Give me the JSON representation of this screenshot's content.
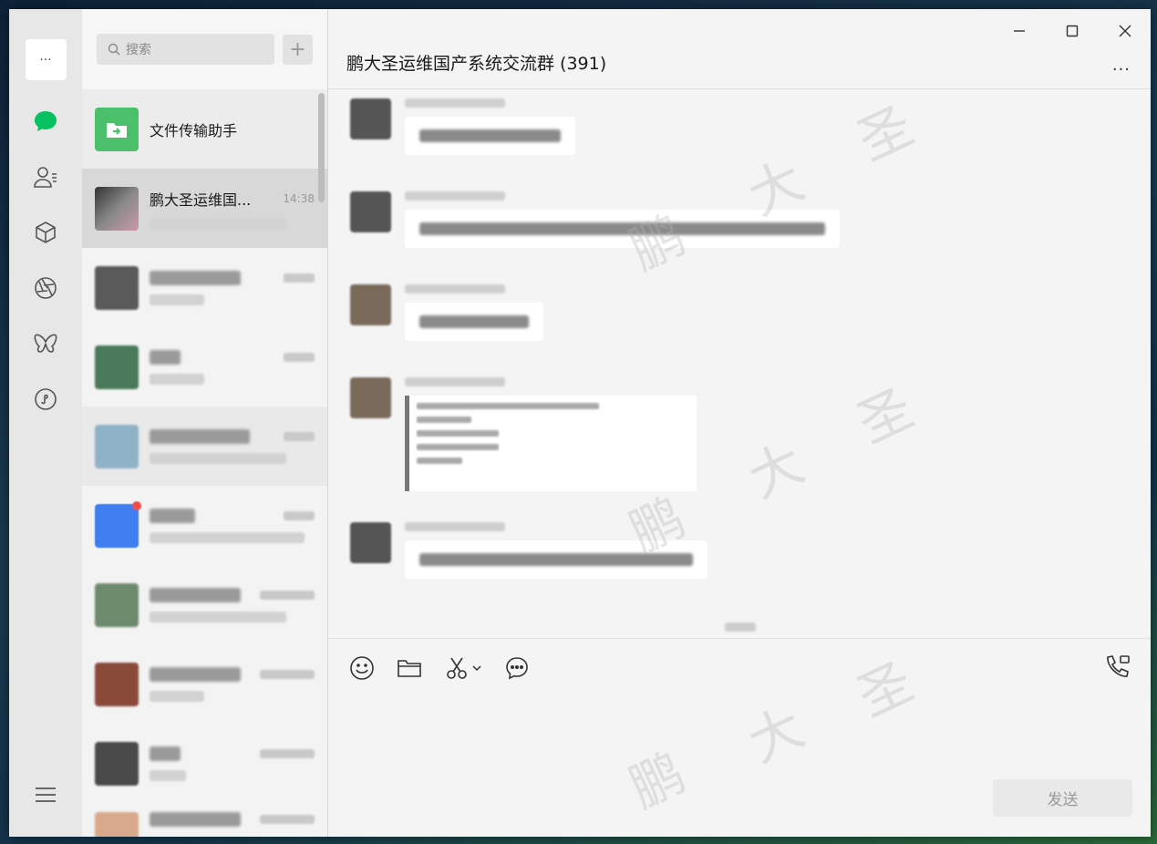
{
  "rail": {
    "menu_dots": "···",
    "icons": [
      "chat-bubble-icon",
      "contacts-icon",
      "cube-icon",
      "aperture-icon",
      "butterfly-icon",
      "mini-program-icon"
    ],
    "active_color": "#07c160",
    "bottom_icon": "menu-icon"
  },
  "sidebar": {
    "search_placeholder": "搜索",
    "add_symbol": "+",
    "conversations": [
      {
        "name": "文件传输助手",
        "time": "",
        "avatar_color": "#4cbf6b"
      },
      {
        "name": "鹏大圣运维国...",
        "time": "14:38",
        "avatar_color": "#6b6b6b"
      },
      {
        "name": "",
        "time": "",
        "avatar_color": "#5a5a5a"
      },
      {
        "name": "",
        "time": "",
        "avatar_color": "#4a7a5a"
      },
      {
        "name": "",
        "time": "",
        "avatar_color": "#8fb2c9"
      },
      {
        "name": "",
        "time": "",
        "avatar_color": "#3f7ef0",
        "badge": true
      },
      {
        "name": "",
        "time": "",
        "avatar_color": "#6d8a6d"
      },
      {
        "name": "",
        "time": "",
        "avatar_color": "#8a4a3a"
      },
      {
        "name": "",
        "time": "",
        "avatar_color": "#4a4a4a"
      },
      {
        "name": "",
        "time": "",
        "avatar_color": "#d8a98a"
      }
    ]
  },
  "chat": {
    "title": "鹏大圣运维国产系统交流群 (391)",
    "window_controls": {
      "minimize": "−",
      "maximize": "☐",
      "close": "✕"
    },
    "more": "···",
    "send_label": "发送",
    "watermark_chars": [
      "鹏",
      "大",
      "圣"
    ]
  }
}
